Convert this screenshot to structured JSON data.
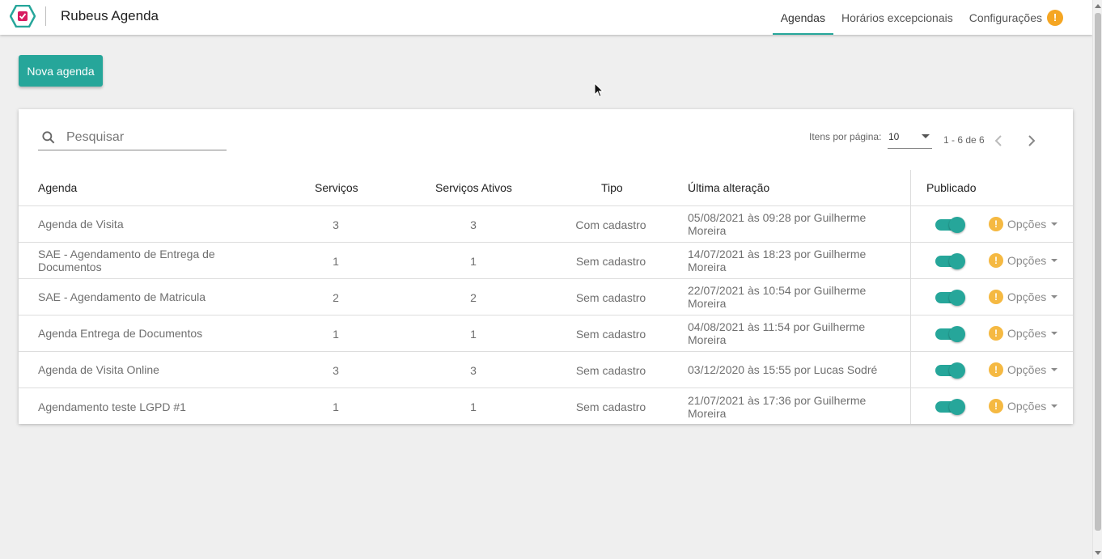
{
  "header": {
    "title": "Rubeus Agenda",
    "nav": [
      {
        "label": "Agendas",
        "active": true
      },
      {
        "label": "Horários excepcionais",
        "active": false
      },
      {
        "label": "Configurações",
        "active": false,
        "badge": "!"
      }
    ]
  },
  "actions": {
    "new_label": "Nova agenda"
  },
  "search": {
    "placeholder": "Pesquisar",
    "value": ""
  },
  "pagination": {
    "per_page_label": "Itens por página:",
    "per_page_value": "10",
    "range": "1 - 6 de 6"
  },
  "table": {
    "headers": {
      "agenda": "Agenda",
      "servicos": "Serviços",
      "ativos": "Serviços Ativos",
      "tipo": "Tipo",
      "alteracao": "Última alteração",
      "publicado": "Publicado"
    },
    "options_label": "Opções",
    "options_badge": "!",
    "rows": [
      {
        "agenda": "Agenda de Visita",
        "servicos": "3",
        "ativos": "3",
        "tipo": "Com cadastro",
        "alteracao": "05/08/2021 às 09:28 por Guilherme Moreira",
        "publicado": true
      },
      {
        "agenda": "SAE - Agendamento de Entrega de Documentos",
        "servicos": "1",
        "ativos": "1",
        "tipo": "Sem cadastro",
        "alteracao": "14/07/2021 às 18:23 por Guilherme Moreira",
        "publicado": true
      },
      {
        "agenda": "SAE - Agendamento de Matricula",
        "servicos": "2",
        "ativos": "2",
        "tipo": "Sem cadastro",
        "alteracao": "22/07/2021 às 10:54 por Guilherme Moreira",
        "publicado": true
      },
      {
        "agenda": "Agenda Entrega de Documentos",
        "servicos": "1",
        "ativos": "1",
        "tipo": "Sem cadastro",
        "alteracao": "04/08/2021 às 11:54 por Guilherme Moreira",
        "publicado": true
      },
      {
        "agenda": "Agenda de Visita Online",
        "servicos": "3",
        "ativos": "3",
        "tipo": "Sem cadastro",
        "alteracao": "03/12/2020 às 15:55 por Lucas Sodré",
        "publicado": true
      },
      {
        "agenda": "Agendamento teste LGPD #1",
        "servicos": "1",
        "ativos": "1",
        "tipo": "Sem cadastro",
        "alteracao": "21/07/2021 às 17:36 por Guilherme Moreira",
        "publicado": true
      }
    ]
  },
  "colors": {
    "accent": "#26a69a",
    "warning": "#f5a623"
  },
  "icons": [
    "app-logo-icon",
    "search-icon",
    "chevron-left-icon",
    "chevron-right-icon",
    "warning-icon",
    "caret-down-icon",
    "mouse-cursor-icon"
  ]
}
